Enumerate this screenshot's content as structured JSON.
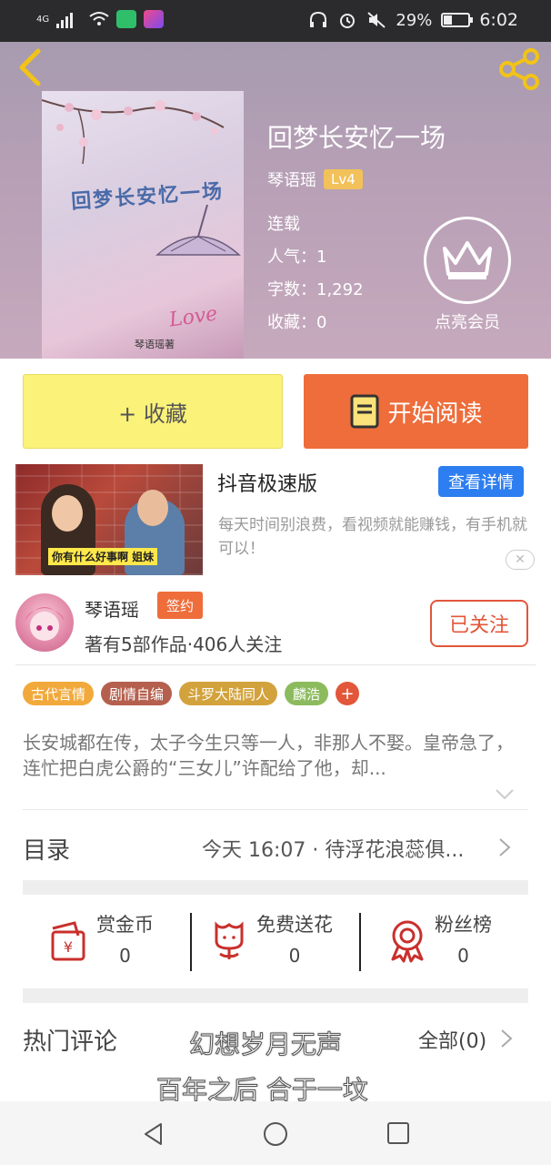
{
  "status_bar": {
    "network": "4G",
    "battery": "29%",
    "time": "6:02"
  },
  "book": {
    "title": "回梦长安忆一场",
    "author": "琴语瑶",
    "level": "Lv4",
    "status": "连载",
    "popularity": "人气：1",
    "word_count": "字数：1,292",
    "favorites": "收藏：0",
    "cover_title": "回梦长安忆一场",
    "cover_author": "琴语瑶著",
    "cover_love": "Love"
  },
  "vip": {
    "label": "点亮会员"
  },
  "actions": {
    "collect_label": "+ 收藏",
    "read_label": "开始阅读"
  },
  "ad": {
    "title": "抖音极速版",
    "button": "查看详情",
    "description": "每天时间别浪费，看视频就能赚钱，有手机就可以！",
    "image_caption": "你有什么好事啊 姐妹",
    "close": "✕"
  },
  "author_card": {
    "name": "琴语瑶",
    "badge": "签约",
    "stats": "著有5部作品·406人关注",
    "follow_label": "已关注"
  },
  "tags": [
    {
      "label": "古代言情",
      "color": "#f2a93b"
    },
    {
      "label": "剧情自编",
      "color": "#b5604e"
    },
    {
      "label": "斗罗大陆同人",
      "color": "#d2a23c"
    },
    {
      "label": "麟浩",
      "color": "#8cbb5e"
    }
  ],
  "tag_more": "+",
  "synopsis": "长安城都在传，太子今生只等一人，非那人不娶。皇帝急了，连忙把白虎公爵的“三女儿”许配给了他，却...",
  "toc": {
    "label": "目录",
    "latest": "今天 16:07 · 待浮花浪蕊俱..."
  },
  "stats": [
    {
      "label": "赏金币",
      "value": "0",
      "icon": "reward-coin-icon"
    },
    {
      "label": "免费送花",
      "value": "0",
      "icon": "flower-icon"
    },
    {
      "label": "粉丝榜",
      "value": "0",
      "icon": "medal-icon"
    }
  ],
  "comments": {
    "label": "热门评论",
    "all_label": "全部(0)"
  },
  "lyrics": {
    "line1": "幻想岁月无声",
    "line2": "百年之后 合于一坟"
  },
  "colors": {
    "accent_orange": "#ee6d3b",
    "collect_yellow": "#fbf27a",
    "ad_blue": "#2d7ef0",
    "follow_red": "#e2563a"
  }
}
